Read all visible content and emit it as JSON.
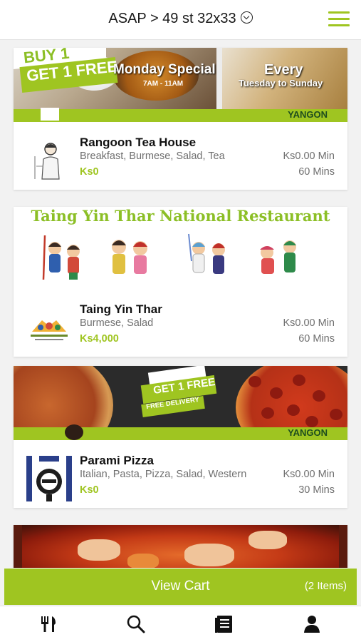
{
  "header": {
    "title": "ASAP > 49 st 32x33",
    "location_chevron_icon": "chevron-circle-icon",
    "menu_icon": "hamburger-menu-icon",
    "accent_color": "#9fc521"
  },
  "restaurants": [
    {
      "name": "Rangoon Tea House",
      "categories": "Breakfast, Burmese, Salad, Tea",
      "price": "Ks0",
      "min_order": "Ks0.00 Min",
      "delivery_time": "60 Mins",
      "banner": {
        "buy_text": "BUY 1",
        "get_text": "GET 1 FREE",
        "special_title": "Monday Special",
        "special_hours": "7AM - 11AM",
        "every_title": "Every",
        "every_sub": "Tuesday to Sunday",
        "brand": "YANGON"
      }
    },
    {
      "name": "Taing Yin Thar",
      "categories": "Burmese, Salad",
      "price": "Ks4,000",
      "min_order": "Ks0.00 Min",
      "delivery_time": "60 Mins",
      "banner": {
        "title": "Taing Yin Thar National Restaurant"
      }
    },
    {
      "name": "Parami Pizza",
      "categories": "Italian, Pasta, Pizza, Salad, Western",
      "price": "Ks0",
      "min_order": "Ks0.00 Min",
      "delivery_time": "30 Mins",
      "banner": {
        "get_text": "GET 1 FREE",
        "delivery_text": "FREE DELIVERY",
        "brand": "YANGON"
      }
    }
  ],
  "cart": {
    "label": "View Cart",
    "count": "(2 Items)"
  },
  "tabs": [
    {
      "icon": "fork-knife-icon"
    },
    {
      "icon": "search-icon"
    },
    {
      "icon": "orders-list-icon"
    },
    {
      "icon": "user-profile-icon"
    }
  ]
}
